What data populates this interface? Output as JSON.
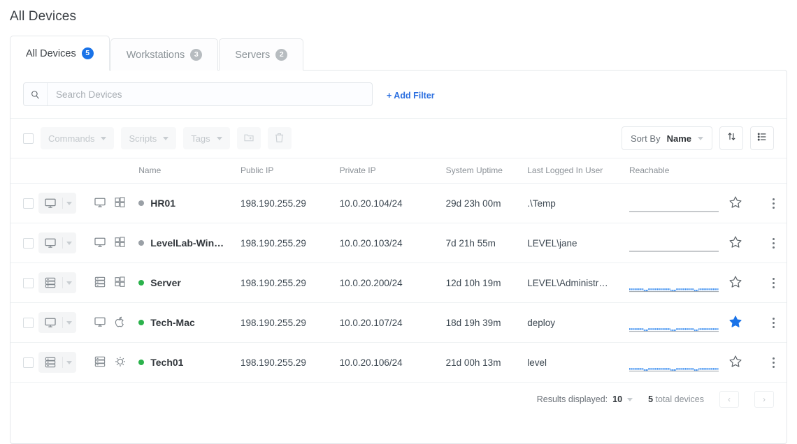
{
  "page": {
    "title": "All Devices"
  },
  "tabs": [
    {
      "label": "All Devices",
      "count": "5",
      "active": true
    },
    {
      "label": "Workstations",
      "count": "3",
      "active": false
    },
    {
      "label": "Servers",
      "count": "2",
      "active": false
    }
  ],
  "search": {
    "placeholder": "Search Devices",
    "value": "",
    "icon": "search-icon"
  },
  "add_filter": {
    "label": "+ Add Filter"
  },
  "toolbar": {
    "commands_label": "Commands",
    "scripts_label": "Scripts",
    "tags_label": "Tags",
    "folder_add_icon": "folder-plus-icon",
    "delete_icon": "trash-icon",
    "sort_by_prefix": "Sort By",
    "sort_by_value": "Name",
    "sort_direction_icon": "sort-arrows-icon",
    "list_view_icon": "list-view-icon"
  },
  "table": {
    "columns": [
      "",
      "",
      "",
      "Name",
      "Public IP",
      "Private IP",
      "System Uptime",
      "Last Logged In User",
      "Reachable",
      "",
      ""
    ],
    "rows": [
      {
        "name": "HR01",
        "status": "offline",
        "device_icon": "monitor-icon",
        "os_icon": "windows-icon",
        "public_ip": "198.190.255.29",
        "private_ip": "10.0.20.104/24",
        "uptime": "29d 23h 00m",
        "user": ".\\Temp",
        "reachable": "none",
        "favorite": false
      },
      {
        "name": "LevelLab-Win…",
        "status": "offline",
        "device_icon": "monitor-icon",
        "os_icon": "windows-icon",
        "public_ip": "198.190.255.29",
        "private_ip": "10.0.20.103/24",
        "uptime": "7d 21h 55m",
        "user": "LEVEL\\jane",
        "reachable": "none",
        "favorite": false
      },
      {
        "name": "Server",
        "status": "online",
        "device_icon": "server-icon",
        "os_icon": "windows-icon",
        "public_ip": "198.190.255.29",
        "private_ip": "10.0.20.200/24",
        "uptime": "12d 10h 19m",
        "user": "LEVEL\\Administr…",
        "reachable": "sparkline",
        "favorite": false
      },
      {
        "name": "Tech-Mac",
        "status": "online",
        "device_icon": "monitor-icon",
        "os_icon": "apple-icon",
        "public_ip": "198.190.255.29",
        "private_ip": "10.0.20.107/24",
        "uptime": "18d 19h 39m",
        "user": "deploy",
        "reachable": "sparkline",
        "favorite": true
      },
      {
        "name": "Tech01",
        "status": "online",
        "device_icon": "server-icon",
        "os_icon": "linux-icon",
        "public_ip": "198.190.255.29",
        "private_ip": "10.0.20.106/24",
        "uptime": "21d 00h 13m",
        "user": "level",
        "reachable": "sparkline",
        "favorite": false
      }
    ]
  },
  "footer": {
    "results_label": "Results displayed:",
    "results_value": "10",
    "total_count": "5",
    "total_label": "total devices",
    "prev_icon": "chevron-left-icon",
    "next_icon": "chevron-right-icon"
  },
  "colors": {
    "accent": "#1a73e8",
    "link": "#2b6fe0",
    "online": "#2bb24c",
    "offline": "#9aa0a6",
    "spark": "#3b8ef0",
    "border": "#e4e7ea"
  }
}
